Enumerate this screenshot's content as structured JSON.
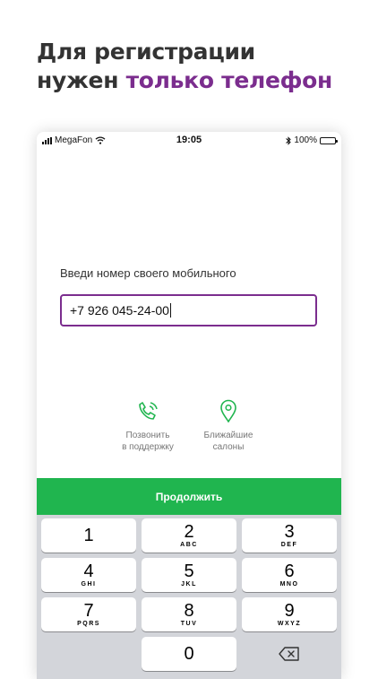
{
  "colors": {
    "accent": "#7b2d8e",
    "green": "#20b54f"
  },
  "headline": {
    "line1": "Для регистрации",
    "line2_plain": "нужен",
    "line2_accent": "только телефон"
  },
  "status_bar": {
    "carrier": "MegaFon",
    "time": "19:05",
    "battery": "100%",
    "battery_level": 1.0
  },
  "form": {
    "prompt": "Введи номер своего мобильного",
    "phone_value": "+7 926 045-24-00"
  },
  "actions": [
    {
      "icon": "phone-call-icon",
      "line1": "Позвонить",
      "line2": "в поддержку"
    },
    {
      "icon": "map-pin-icon",
      "line1": "Ближайшие",
      "line2": "салоны"
    }
  ],
  "continue_label": "Продолжить",
  "keypad": [
    {
      "num": "1",
      "letters": ""
    },
    {
      "num": "2",
      "letters": "ABC"
    },
    {
      "num": "3",
      "letters": "DEF"
    },
    {
      "num": "4",
      "letters": "GHI"
    },
    {
      "num": "5",
      "letters": "JKL"
    },
    {
      "num": "6",
      "letters": "MNO"
    },
    {
      "num": "7",
      "letters": "PQRS"
    },
    {
      "num": "8",
      "letters": "TUV"
    },
    {
      "num": "9",
      "letters": "WXYZ"
    },
    {
      "num": "0",
      "letters": ""
    }
  ],
  "delete_icon": "backspace-icon"
}
